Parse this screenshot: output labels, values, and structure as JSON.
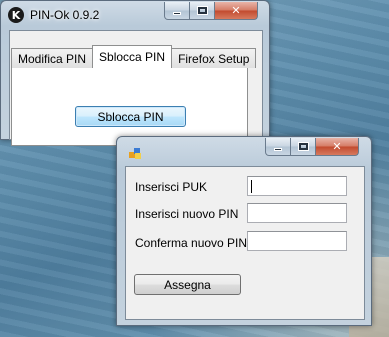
{
  "main_window": {
    "title": "PIN-Ok 0.9.2",
    "logo_text": "K",
    "tabs": [
      {
        "label": "Modifica PIN",
        "active": false
      },
      {
        "label": "Sblocca PIN",
        "active": true
      },
      {
        "label": "Firefox Setup",
        "active": false
      }
    ],
    "unlock_button_label": "Sblocca PIN"
  },
  "dialog": {
    "title": "",
    "fields": [
      {
        "label": "Inserisci PUK",
        "value": ""
      },
      {
        "label": "Inserisci  nuovo  PIN",
        "value": ""
      },
      {
        "label": "Conferma nuovo PIN",
        "value": ""
      }
    ],
    "assign_button_label": "Assegna"
  },
  "caption_icons": [
    "minimize-icon",
    "maximize-icon",
    "close-icon"
  ],
  "colors": {
    "client_bg": "#f0f0f0",
    "focused_button": "#3c7fb1",
    "close_button": "#c24a2e"
  }
}
